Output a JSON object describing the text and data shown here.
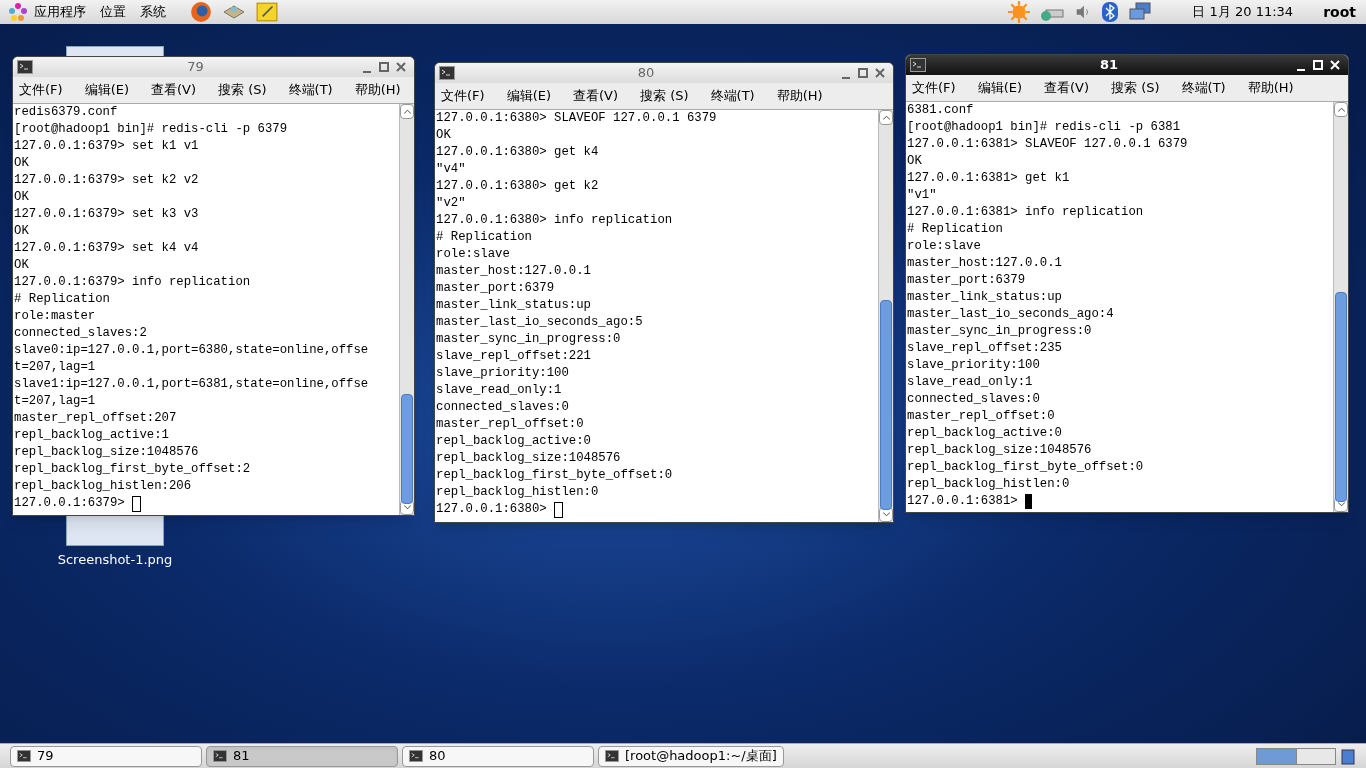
{
  "top_panel": {
    "menus": [
      "应用程序",
      "位置",
      "系统"
    ],
    "clock": "日 1月 20 11:34",
    "user": "root"
  },
  "desktop_icon": {
    "label": "Screenshot-1.png"
  },
  "windows": [
    {
      "title": "79",
      "active": false,
      "menu": [
        "文件(F)",
        "编辑(E)",
        "查看(V)",
        "搜索 (S)",
        "终端(T)",
        "帮助(H)"
      ],
      "lines": [
        "redis6379.conf",
        "[root@hadoop1 bin]# redis-cli -p 6379",
        "127.0.0.1:6379> set k1 v1",
        "OK",
        "127.0.0.1:6379> set k2 v2",
        "OK",
        "127.0.0.1:6379> set k3 v3",
        "OK",
        "127.0.0.1:6379> set k4 v4",
        "OK",
        "127.0.0.1:6379> info replication",
        "# Replication",
        "role:master",
        "connected_slaves:2",
        "slave0:ip=127.0.0.1,port=6380,state=online,offse",
        "t=207,lag=1",
        "slave1:ip=127.0.0.1,port=6381,state=online,offse",
        "t=207,lag=1",
        "master_repl_offset:207",
        "repl_backlog_active:1",
        "repl_backlog_size:1048576",
        "repl_backlog_first_byte_offset:2",
        "repl_backlog_histlen:206"
      ],
      "prompt": "127.0.0.1:6379> "
    },
    {
      "title": "80",
      "active": false,
      "menu": [
        "文件(F)",
        "编辑(E)",
        "查看(V)",
        "搜索 (S)",
        "终端(T)",
        "帮助(H)"
      ],
      "lines": [
        "127.0.0.1:6380> SLAVEOF 127.0.0.1 6379",
        "OK",
        "127.0.0.1:6380> get k4",
        "\"v4\"",
        "127.0.0.1:6380> get k2",
        "\"v2\"",
        "127.0.0.1:6380> info replication",
        "# Replication",
        "role:slave",
        "master_host:127.0.0.1",
        "master_port:6379",
        "master_link_status:up",
        "master_last_io_seconds_ago:5",
        "master_sync_in_progress:0",
        "slave_repl_offset:221",
        "slave_priority:100",
        "slave_read_only:1",
        "connected_slaves:0",
        "master_repl_offset:0",
        "repl_backlog_active:0",
        "repl_backlog_size:1048576",
        "repl_backlog_first_byte_offset:0",
        "repl_backlog_histlen:0"
      ],
      "prompt": "127.0.0.1:6380> "
    },
    {
      "title": "81",
      "active": true,
      "menu": [
        "文件(F)",
        "编辑(E)",
        "查看(V)",
        "搜索 (S)",
        "终端(T)",
        "帮助(H)"
      ],
      "lines": [
        "6381.conf",
        "[root@hadoop1 bin]# redis-cli -p 6381",
        "127.0.0.1:6381> SLAVEOF 127.0.0.1 6379",
        "OK",
        "127.0.0.1:6381> get k1",
        "\"v1\"",
        "127.0.0.1:6381> info replication",
        "# Replication",
        "role:slave",
        "master_host:127.0.0.1",
        "master_port:6379",
        "master_link_status:up",
        "master_last_io_seconds_ago:4",
        "master_sync_in_progress:0",
        "slave_repl_offset:235",
        "slave_priority:100",
        "slave_read_only:1",
        "connected_slaves:0",
        "master_repl_offset:0",
        "repl_backlog_active:0",
        "repl_backlog_size:1048576",
        "repl_backlog_first_byte_offset:0",
        "repl_backlog_histlen:0"
      ],
      "prompt": "127.0.0.1:6381> "
    }
  ],
  "taskbar": [
    {
      "label": "79",
      "selected": false
    },
    {
      "label": "81",
      "selected": true
    },
    {
      "label": "80",
      "selected": false
    },
    {
      "label": "[root@hadoop1:~/桌面]",
      "selected": false
    }
  ]
}
